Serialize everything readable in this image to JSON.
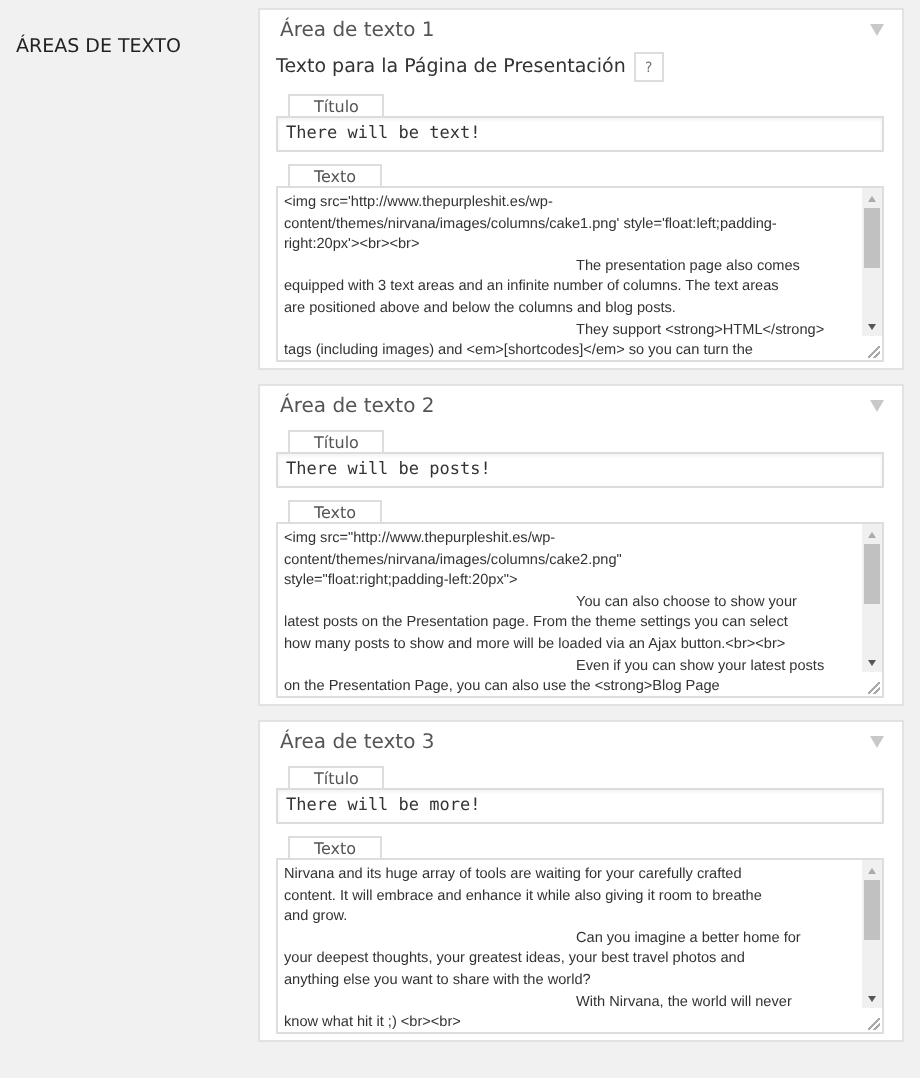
{
  "section_label": "ÁREAS DE TEXTO",
  "panels": [
    {
      "title": "Área de texto 1",
      "description": "Texto para la Página de Presentación",
      "help": "?",
      "title_field": {
        "label": "Título",
        "value": "There will be text!"
      },
      "text_field": {
        "label": "Texto",
        "lines": [
          {
            "text": "<img src='http://www.thepurpleshit.es/wp-",
            "indented": false
          },
          {
            "text": "content/themes/nirvana/images/columns/cake1.png' style='float:left;padding-",
            "indented": false
          },
          {
            "text": "right:20px'><br><br>",
            "indented": false
          },
          {
            "text": "The presentation page also comes",
            "indented": true
          },
          {
            "text": "equipped with 3 text areas and an infinite number of columns. The text areas",
            "indented": false
          },
          {
            "text": "are positioned above and below the columns and blog posts.",
            "indented": false
          },
          {
            "text": "They support <strong>HTML</strong>",
            "indented": true
          },
          {
            "text": "tags (including images) and <em>[shortcodes]</em> so you can turn the",
            "indented": false
          }
        ]
      }
    },
    {
      "title": "Área de texto 2",
      "title_field": {
        "label": "Título",
        "value": "There will be posts!"
      },
      "text_field": {
        "label": "Texto",
        "lines": [
          {
            "text": "<img src=\"http://www.thepurpleshit.es/wp-",
            "indented": false
          },
          {
            "text": "content/themes/nirvana/images/columns/cake2.png\"",
            "indented": false
          },
          {
            "text": "style=\"float:right;padding-left:20px\">",
            "indented": false
          },
          {
            "text": "You can also choose to show your",
            "indented": true
          },
          {
            "text": "latest posts on the Presentation page. From the theme settings you can select",
            "indented": false
          },
          {
            "text": "how many posts to show and more will be loaded via an Ajax button.<br><br>",
            "indented": false
          },
          {
            "text": "Even if you can show your latest posts",
            "indented": true
          },
          {
            "text": "on the Presentation Page, you can also use the <strong>Blog Page",
            "indented": false
          }
        ]
      }
    },
    {
      "title": "Área de texto 3",
      "title_field": {
        "label": "Título",
        "value": "There will be more!"
      },
      "text_field": {
        "label": "Texto",
        "lines": [
          {
            "text": "Nirvana and its huge array of tools are waiting for your carefully crafted",
            "indented": false
          },
          {
            "text": "content. It will embrace and enhance it while also giving it room to breathe",
            "indented": false
          },
          {
            "text": "and grow.",
            "indented": false
          },
          {
            "text": "Can you imagine a better home for",
            "indented": true
          },
          {
            "text": "your deepest thoughts, your greatest ideas, your best travel photos and",
            "indented": false
          },
          {
            "text": "anything else you want to share with the world?",
            "indented": false
          },
          {
            "text": "With Nirvana, the world will never",
            "indented": true
          },
          {
            "text": "know what hit it ;) <br><br>",
            "indented": false
          }
        ]
      }
    }
  ]
}
